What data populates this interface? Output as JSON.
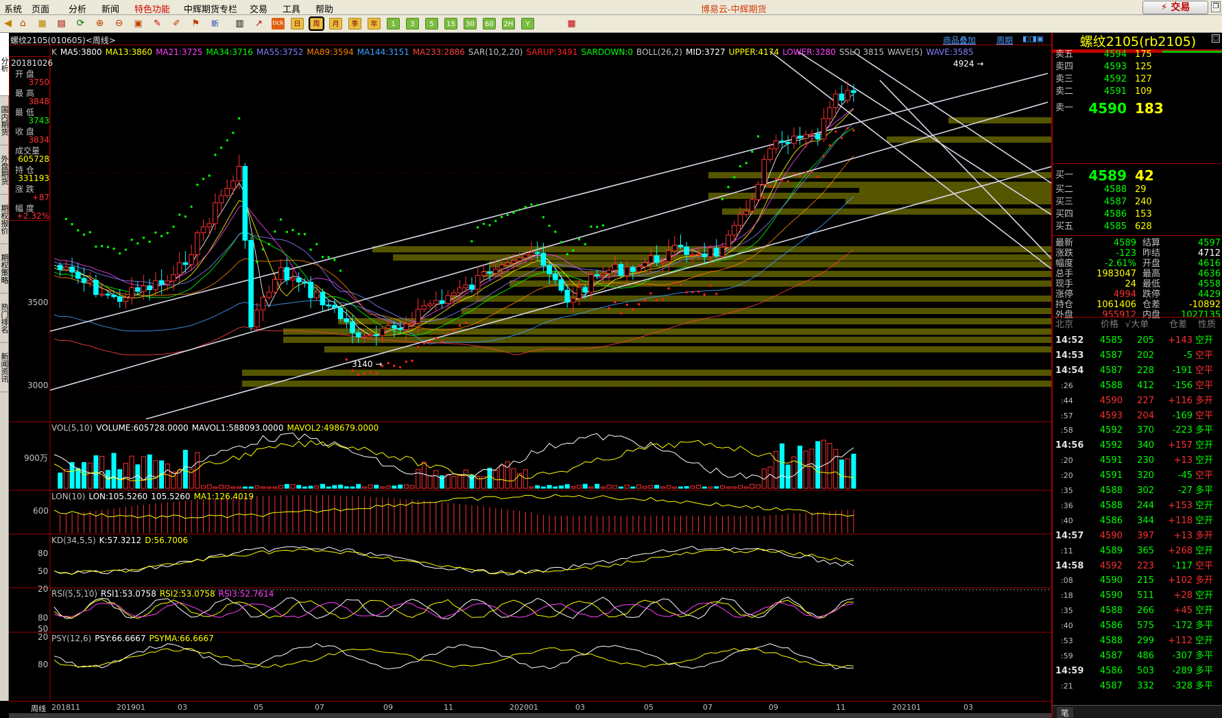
{
  "menu": {
    "items": [
      "系统",
      "页面",
      "分析",
      "新闻",
      "特色功能",
      "中辉期货专栏",
      "交易",
      "工具",
      "帮助"
    ],
    "title": "博易云-中辉期货",
    "trade_button": "交易"
  },
  "toolbar": {
    "period_buttons": [
      "日",
      "周",
      "月",
      "季",
      "年",
      "1",
      "3",
      "5",
      "15",
      "30",
      "60",
      "2H",
      "Y"
    ]
  },
  "leftbar": {
    "tabs": [
      "分析",
      "国内期货",
      "外盘期货",
      "期权报价",
      "期权策略",
      "热门排名",
      "新闻资讯"
    ]
  },
  "chart": {
    "symbol_header": "螺纹2105(010605)<周线>",
    "link_overlay": "商品叠加",
    "link_period": "周期",
    "main_legend": [
      {
        "text": "K",
        "color": "#c0c0c0"
      },
      {
        "text": "MA5:3800",
        "color": "#ffffff"
      },
      {
        "text": "MA13:3860",
        "color": "#ffff00"
      },
      {
        "text": "MA21:3725",
        "color": "#ff40ff"
      },
      {
        "text": "MA34:3716",
        "color": "#00ff00"
      },
      {
        "text": "MA55:3752",
        "color": "#8080ff"
      },
      {
        "text": "MA89:3594",
        "color": "#ff8000"
      },
      {
        "text": "MA144:3151",
        "color": "#40a0ff"
      },
      {
        "text": "MA233:2886",
        "color": "#ff4040"
      },
      {
        "text": "SAR(10,2,20)",
        "color": "#c0c0c0"
      },
      {
        "text": "SARUP:3491",
        "color": "#ff2020"
      },
      {
        "text": "SARDOWN:0",
        "color": "#00ff00"
      },
      {
        "text": "BOLL(26,2)",
        "color": "#c0c0c0"
      },
      {
        "text": "MID:3727",
        "color": "#ffffff"
      },
      {
        "text": "UPPER:4174",
        "color": "#ffff00"
      },
      {
        "text": "LOWER:3280",
        "color": "#ff40ff"
      },
      {
        "text": "SSLO 3815",
        "color": "#c0c0c0"
      },
      {
        "text": "WAVE(5)",
        "color": "#c0c0c0"
      },
      {
        "text": "WAVE:3585",
        "color": "#8080ff"
      }
    ],
    "y_labels": [
      "3500",
      "3000"
    ],
    "annotations": {
      "high": "4924",
      "low": "3140"
    },
    "info": {
      "date": "20181026",
      "labels": [
        "开 盘",
        "最 高",
        "最 低",
        "收 盘",
        "成交量",
        "持 仓",
        "涨 跌",
        "幅 度"
      ],
      "values": [
        "3750",
        "3848",
        "3743",
        "3834",
        "605728",
        "331193",
        "+87",
        "+2.32%"
      ]
    },
    "vol_legend": [
      {
        "text": "VOL(5,10)",
        "color": "#c0c0c0"
      },
      {
        "text": "VOLUME:605728.0000",
        "color": "#ffffff"
      },
      {
        "text": "MAVOL1:588093.0000",
        "color": "#ffffff"
      },
      {
        "text": "MAVOL2:498679.0000",
        "color": "#ffff00"
      }
    ],
    "vol_ylabel": "900万",
    "lon_legend": [
      {
        "text": "LON(10)",
        "color": "#c0c0c0"
      },
      {
        "text": "LON:105.5260",
        "color": "#ffffff"
      },
      {
        "text": "105.5260",
        "color": "#ffffff"
      },
      {
        "text": "MA1:126.4019",
        "color": "#ffff00"
      }
    ],
    "lon_ylabel": "600",
    "kd_legend": [
      {
        "text": "KD(34,5,5)",
        "color": "#c0c0c0"
      },
      {
        "text": "K:57.3212",
        "color": "#ffffff"
      },
      {
        "text": "D:56.7006",
        "color": "#ffff00"
      }
    ],
    "kd_ylabels": [
      "80",
      "50",
      "20"
    ],
    "rsi_legend": [
      {
        "text": "RSI(5,5,10)",
        "color": "#c0c0c0"
      },
      {
        "text": "RSI1:53.0758",
        "color": "#ffffff"
      },
      {
        "text": "RSI2:53.0758",
        "color": "#ffff00"
      },
      {
        "text": "RSI3:52.7614",
        "color": "#ff40ff"
      }
    ],
    "rsi_ylabels": [
      "80",
      "50",
      "20"
    ],
    "psy_legend": [
      {
        "text": "PSY(12,6)",
        "color": "#c0c0c0"
      },
      {
        "text": "PSY:66.6667",
        "color": "#ffffff"
      },
      {
        "text": "PSYMA:66.6667",
        "color": "#ffff00"
      }
    ],
    "psy_ylabel": "80",
    "x_labels": [
      "201811",
      "201901",
      "03",
      "05",
      "07",
      "09",
      "11",
      "202001",
      "03",
      "05",
      "07",
      "09",
      "11",
      "202101",
      "03"
    ],
    "x_period_label": "周线"
  },
  "quote": {
    "title": "螺纹2105(rb2105)",
    "asks": [
      {
        "label": "卖五",
        "price": "4594",
        "vol": "175"
      },
      {
        "label": "卖四",
        "price": "4593",
        "vol": "125"
      },
      {
        "label": "卖三",
        "price": "4592",
        "vol": "127"
      },
      {
        "label": "卖二",
        "price": "4591",
        "vol": "109"
      },
      {
        "label": "卖一",
        "price": "4590",
        "vol": "183"
      }
    ],
    "bids": [
      {
        "label": "买一",
        "price": "4589",
        "vol": "42"
      },
      {
        "label": "买二",
        "price": "4588",
        "vol": "29"
      },
      {
        "label": "买三",
        "price": "4587",
        "vol": "240"
      },
      {
        "label": "买四",
        "price": "4586",
        "vol": "153"
      },
      {
        "label": "买五",
        "price": "4585",
        "vol": "628"
      }
    ],
    "stats": [
      {
        "l1": "最新",
        "v1": "4589",
        "c1": "#00ff00",
        "l2": "结算",
        "v2": "4597",
        "c2": "#00ff00"
      },
      {
        "l1": "涨跌",
        "v1": "-123",
        "c1": "#00ff00",
        "l2": "昨结",
        "v2": "4712",
        "c2": "#ffffff"
      },
      {
        "l1": "幅度",
        "v1": "-2.61%",
        "c1": "#00ff00",
        "l2": "开盘",
        "v2": "4616",
        "c2": "#00ff00"
      },
      {
        "l1": "总手",
        "v1": "1983047",
        "c1": "#ffff00",
        "l2": "最高",
        "v2": "4636",
        "c2": "#00ff00"
      },
      {
        "l1": "现手",
        "v1": "24",
        "c1": "#ffff00",
        "l2": "最低",
        "v2": "4558",
        "c2": "#00ff00"
      },
      {
        "l1": "涨停",
        "v1": "4994",
        "c1": "#ff3030",
        "l2": "跌停",
        "v2": "4429",
        "c2": "#00ff00"
      },
      {
        "l1": "持仓",
        "v1": "1061406",
        "c1": "#ffff00",
        "l2": "仓差",
        "v2": "-10892",
        "c2": "#ffff00"
      },
      {
        "l1": "外盘",
        "v1": "955912",
        "c1": "#ff3030",
        "l2": "内盘",
        "v2": "1027135",
        "c2": "#00ff00"
      }
    ],
    "tick_header": {
      "time": "北京",
      "price": "价格",
      "vol": "√大单",
      "chg": "仓差",
      "nature": "性质"
    },
    "ticks": [
      {
        "t": "14:52",
        "p": "4585",
        "pc": "#00ff00",
        "q": "205",
        "c": "+143",
        "n": "空开",
        "nc": "#00ff00"
      },
      {
        "t": "14:53",
        "p": "4587",
        "pc": "#00ff00",
        "q": "202",
        "c": "-5",
        "n": "空平",
        "nc": "#ff3030"
      },
      {
        "t": "14:54",
        "p": "4587",
        "pc": "#00ff00",
        "q": "228",
        "c": "-191",
        "n": "空平",
        "nc": "#ff3030"
      },
      {
        "t": ":26",
        "p": "4588",
        "pc": "#00ff00",
        "q": "412",
        "c": "-156",
        "n": "空平",
        "nc": "#ff3030"
      },
      {
        "t": ":44",
        "p": "4590",
        "pc": "#ff3030",
        "q": "227",
        "c": "+116",
        "n": "多开",
        "nc": "#ff3030"
      },
      {
        "t": ":57",
        "p": "4593",
        "pc": "#ff3030",
        "q": "204",
        "c": "-169",
        "n": "空平",
        "nc": "#ff3030"
      },
      {
        "t": ":58",
        "p": "4592",
        "pc": "#00ff00",
        "q": "370",
        "c": "-223",
        "n": "多平",
        "nc": "#00ff00"
      },
      {
        "t": "14:56",
        "p": "4592",
        "pc": "#00ff00",
        "q": "340",
        "c": "+157",
        "n": "空开",
        "nc": "#00ff00"
      },
      {
        "t": ":20",
        "p": "4591",
        "pc": "#00ff00",
        "q": "230",
        "c": "+13",
        "n": "空开",
        "nc": "#00ff00"
      },
      {
        "t": ":20",
        "p": "4591",
        "pc": "#00ff00",
        "q": "320",
        "c": "-45",
        "n": "空平",
        "nc": "#ff3030"
      },
      {
        "t": ":35",
        "p": "4588",
        "pc": "#00ff00",
        "q": "302",
        "c": "-27",
        "n": "多平",
        "nc": "#00ff00"
      },
      {
        "t": ":36",
        "p": "4588",
        "pc": "#00ff00",
        "q": "244",
        "c": "+153",
        "n": "空开",
        "nc": "#00ff00"
      },
      {
        "t": ":40",
        "p": "4586",
        "pc": "#00ff00",
        "q": "344",
        "c": "+118",
        "n": "空开",
        "nc": "#00ff00"
      },
      {
        "t": "14:57",
        "p": "4590",
        "pc": "#ff3030",
        "q": "397",
        "c": "+13",
        "n": "多开",
        "nc": "#ff3030"
      },
      {
        "t": ":11",
        "p": "4589",
        "pc": "#00ff00",
        "q": "365",
        "c": "+268",
        "n": "空开",
        "nc": "#00ff00"
      },
      {
        "t": "14:58",
        "p": "4592",
        "pc": "#ff3030",
        "q": "223",
        "c": "-117",
        "n": "空平",
        "nc": "#ff3030"
      },
      {
        "t": ":08",
        "p": "4590",
        "pc": "#00ff00",
        "q": "215",
        "c": "+102",
        "n": "多开",
        "nc": "#ff3030"
      },
      {
        "t": ":18",
        "p": "4590",
        "pc": "#00ff00",
        "q": "511",
        "c": "+28",
        "n": "空开",
        "nc": "#00ff00"
      },
      {
        "t": ":35",
        "p": "4588",
        "pc": "#00ff00",
        "q": "266",
        "c": "+45",
        "n": "空开",
        "nc": "#00ff00"
      },
      {
        "t": ":40",
        "p": "4586",
        "pc": "#00ff00",
        "q": "575",
        "c": "-172",
        "n": "多平",
        "nc": "#00ff00"
      },
      {
        "t": ":53",
        "p": "4588",
        "pc": "#00ff00",
        "q": "299",
        "c": "+112",
        "n": "空开",
        "nc": "#00ff00"
      },
      {
        "t": ":59",
        "p": "4587",
        "pc": "#00ff00",
        "q": "486",
        "c": "-307",
        "n": "多平",
        "nc": "#00ff00"
      },
      {
        "t": "14:59",
        "p": "4586",
        "pc": "#00ff00",
        "q": "503",
        "c": "-289",
        "n": "多平",
        "nc": "#00ff00"
      },
      {
        "t": ":21",
        "p": "4587",
        "pc": "#00ff00",
        "q": "332",
        "c": "-328",
        "n": "多平",
        "nc": "#00ff00"
      }
    ],
    "bottom_tab": "笔"
  }
}
